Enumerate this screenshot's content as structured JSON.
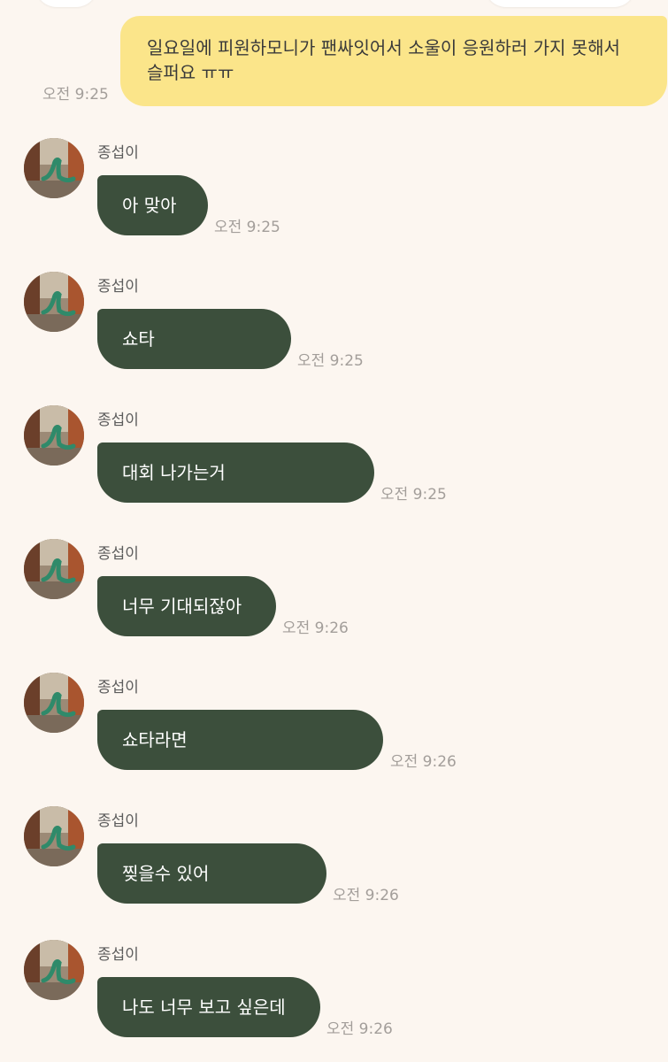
{
  "colors": {
    "background": "#fcf6f0",
    "outgoing_bubble": "#fbe58a",
    "incoming_bubble": "#3c4f3c",
    "timestamp": "#a39e9a"
  },
  "outgoing_message": {
    "text": "일요일에 피원하모니가 팬싸잇어서 소울이 응원하러 가지 못해서 슬퍼요 ㅠㅠ",
    "time": "오전 9:25"
  },
  "messages": [
    {
      "sender": "종섭이",
      "text": "아 맞아",
      "time": "오전 9:25",
      "avatar": "lizard-avatar-icon"
    },
    {
      "sender": "종섭이",
      "text": "쇼타",
      "time": "오전 9:25",
      "avatar": "lizard-avatar-icon"
    },
    {
      "sender": "종섭이",
      "text": "대회 나가는거",
      "time": "오전 9:25",
      "avatar": "lizard-avatar-icon"
    },
    {
      "sender": "종섭이",
      "text": "너무 기대되잖아",
      "time": "오전 9:26",
      "avatar": "lizard-avatar-icon"
    },
    {
      "sender": "종섭이",
      "text": "쇼타라면",
      "time": "오전 9:26",
      "avatar": "lizard-avatar-icon"
    },
    {
      "sender": "종섭이",
      "text": "찢을수 있어",
      "time": "오전 9:26",
      "avatar": "lizard-avatar-icon"
    },
    {
      "sender": "종섭이",
      "text": "나도 너무 보고 싶은데",
      "time": "오전 9:26",
      "avatar": "lizard-avatar-icon"
    }
  ]
}
